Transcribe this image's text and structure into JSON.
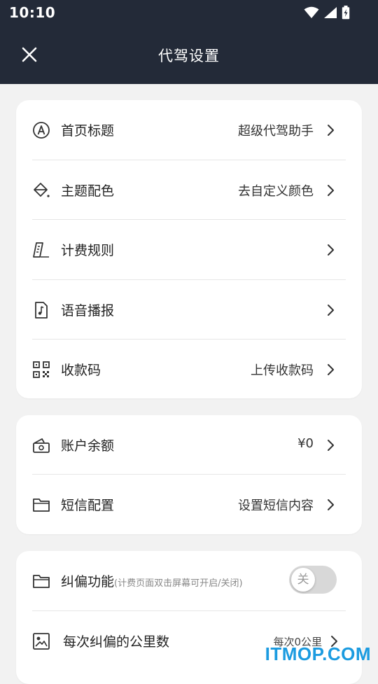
{
  "status_bar": {
    "time": "10:10"
  },
  "appbar": {
    "title": "代驾设置"
  },
  "card1": {
    "rows": [
      {
        "label": "首页标题",
        "value": "超级代驾助手",
        "icon": "compass-icon"
      },
      {
        "label": "主题配色",
        "value": "去自定义颜色",
        "icon": "paint-bucket-icon"
      },
      {
        "label": "计费规则",
        "value": "",
        "icon": "ruler-icon"
      },
      {
        "label": "语音播报",
        "value": "",
        "icon": "music-file-icon"
      },
      {
        "label": "收款码",
        "value": "上传收款码",
        "icon": "qr-code-icon"
      }
    ]
  },
  "card2": {
    "rows": [
      {
        "label": "账户余额",
        "value": "¥0",
        "icon": "wallet-icon"
      },
      {
        "label": "短信配置",
        "value": "设置短信内容",
        "icon": "folder-icon"
      }
    ]
  },
  "card3": {
    "correction": {
      "label": "纠偏功能",
      "hint": "(计费页面双击屏幕可开启/关闭)",
      "toggle_label": "关",
      "enabled": false,
      "icon": "folder-icon"
    },
    "distance": {
      "label": "每次纠偏的公里数",
      "value": "每次0公里",
      "icon": "image-frame-icon"
    }
  },
  "watermark": "ITMOP.COM",
  "colors": {
    "appbar": "#232a38",
    "background": "#f2f2f2",
    "watermark": "#1b9be0"
  }
}
